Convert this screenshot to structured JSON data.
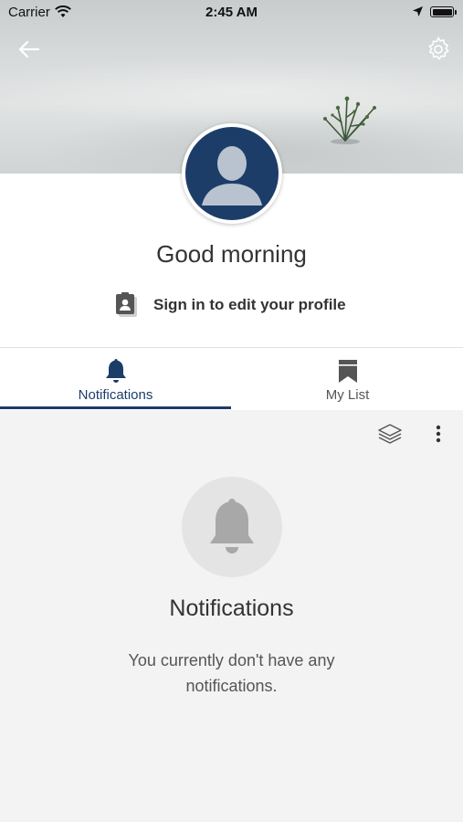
{
  "status_bar": {
    "carrier": "Carrier",
    "time": "2:45 AM"
  },
  "header": {
    "back_icon": "arrow-left-icon",
    "settings_icon": "gear-icon"
  },
  "profile": {
    "greeting": "Good morning",
    "sign_in_label": "Sign in to edit your profile",
    "sign_in_icon": "profile-clipboard-icon",
    "avatar_icon": "user-silhouette-icon"
  },
  "tabs": [
    {
      "label": "Notifications",
      "icon": "bell-icon",
      "active": true
    },
    {
      "label": "My List",
      "icon": "bookmark-icon",
      "active": false
    }
  ],
  "toolbar": {
    "layers_icon": "layers-icon",
    "more_icon": "more-vertical-icon"
  },
  "empty_state": {
    "icon": "bell-icon",
    "title": "Notifications",
    "description": "You currently don't have any notifications."
  },
  "colors": {
    "accent": "#1d3d69",
    "background": "#f3f3f3",
    "card": "#ffffff"
  }
}
